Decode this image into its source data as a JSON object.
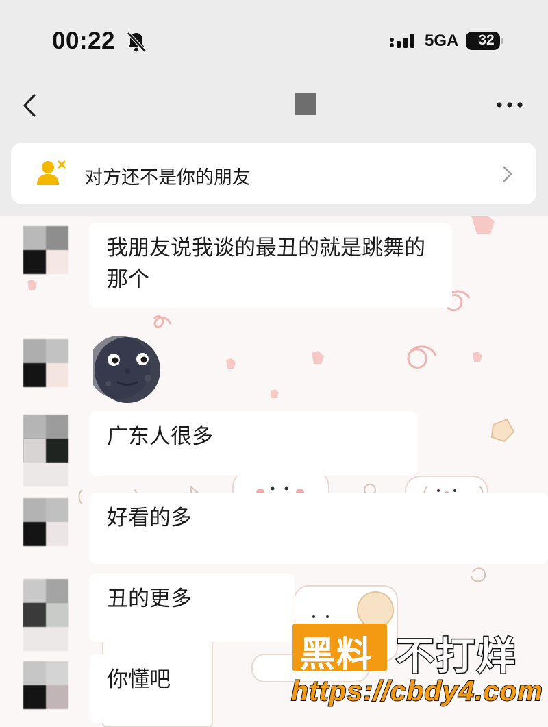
{
  "status_bar": {
    "time": "00:22",
    "network": "5GA",
    "battery": "32",
    "icons": [
      "bell-slash-icon",
      "signal-icon"
    ]
  },
  "nav": {
    "back_icon": "chevron-left-icon",
    "more_icon": "ellipsis-icon"
  },
  "notice": {
    "icon": "add-friend-icon",
    "text": "对方还不是你的朋友",
    "chevron": "chevron-right-icon"
  },
  "messages": [
    {
      "text": "我朋友说我谈的最丑的就是跳舞的那个"
    },
    {
      "sticker": "new-moon-face-emoji"
    },
    {
      "text": "广东人很多"
    },
    {
      "text": "好看的多"
    },
    {
      "text": "丑的更多"
    },
    {
      "text": "你懂吧"
    }
  ],
  "watermark": {
    "main": "黑料",
    "tail": "不打烊",
    "url": "https://cbdy4.com"
  },
  "colors": {
    "header_bg": "#ececec",
    "chat_bg": "#fbf7f6",
    "bubble_bg": "#ffffff",
    "friend_icon": "#f5b800",
    "watermark_orange": "#f49a12"
  }
}
